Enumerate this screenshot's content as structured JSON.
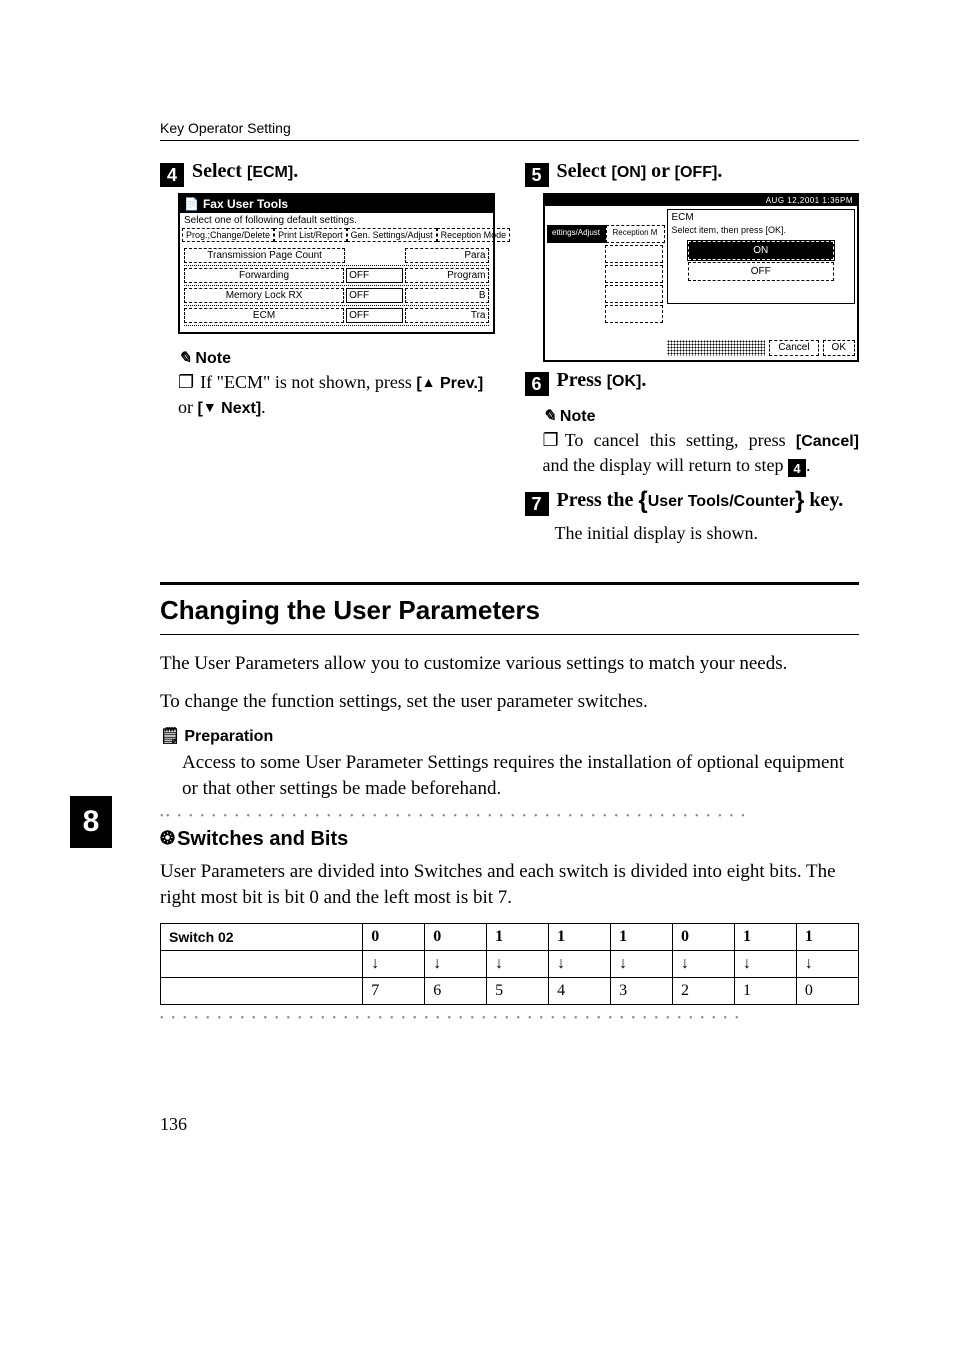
{
  "header": {
    "running": "Key Operator Setting"
  },
  "left": {
    "step4": {
      "num": "4",
      "text_a": "Select ",
      "btn": "[ECM]",
      "text_b": "."
    },
    "lcd": {
      "title": "Fax User Tools",
      "sub": "Select one of following default settings.",
      "tabs": [
        "Prog.;Change/Delete",
        "Print List/Report",
        "Gen. Settings/Adjust",
        "Reception Mode"
      ],
      "rows": [
        {
          "a": "Transmission Page Count",
          "b": "",
          "c": "Para"
        },
        {
          "a": "Forwarding",
          "b": "OFF",
          "c": "Program"
        },
        {
          "a": "Memory Lock RX",
          "b": "OFF",
          "c": "B"
        },
        {
          "a": "ECM",
          "b": "OFF",
          "c": "Tra"
        }
      ]
    },
    "note": {
      "head": "Note",
      "body_a": "If \"ECM\" is not shown, press ",
      "btn1": "[U Prev.]",
      "body_b": " or ",
      "btn2": "[T Next]",
      "body_c": "."
    }
  },
  "right": {
    "step5": {
      "num": "5",
      "text_a": "Select ",
      "btn1": "[ON]",
      "text_b": " or ",
      "btn2": "[OFF]",
      "text_c": "."
    },
    "lcd": {
      "datebar": "AUG   12,2001   1:36PM",
      "left_a": "ettings/Adjust",
      "left_b": "Reception M",
      "panel_title": "ECM",
      "panel_sub": "Select item, then press [OK].",
      "on": "ON",
      "off": "OFF",
      "cancel": "Cancel",
      "ok": "OK"
    },
    "step6": {
      "num": "6",
      "text_a": "Press ",
      "btn": "[OK]",
      "text_b": "."
    },
    "note6": {
      "head": "Note",
      "body_a": "To cancel this setting, press ",
      "btn": "[Cancel]",
      "body_b": " and the display will return to step ",
      "stepref": "4",
      "body_c": "."
    },
    "step7": {
      "num": "7",
      "text_a": "Press the ",
      "key": "User Tools/Counter",
      "text_b": " key."
    },
    "step7_body": "The initial display is shown."
  },
  "section": {
    "title": "Changing the User Parameters",
    "p1": "The User Parameters allow you to customize various settings to match your needs.",
    "p2": "To change the function settings, set the user parameter switches.",
    "prep_head": "Preparation",
    "prep_body": "Access to some User Parameter Settings requires the installation of optional equipment or that other settings be made beforehand.",
    "sub_head": "Switches and Bits",
    "sub_p": "User Parameters are divided into Switches and each switch is divided into eight bits. The right most bit is bit 0 and the left most is bit 7.",
    "table": {
      "row_label": "Switch 02",
      "row1": [
        "0",
        "0",
        "1",
        "1",
        "1",
        "0",
        "1",
        "1"
      ],
      "row2": [
        "↓",
        "↓",
        "↓",
        "↓",
        "↓",
        "↓",
        "↓",
        "↓"
      ],
      "row3": [
        "7",
        "6",
        "5",
        "4",
        "3",
        "2",
        "1",
        "0"
      ]
    }
  },
  "sidetab": "8",
  "pagenum": "136"
}
